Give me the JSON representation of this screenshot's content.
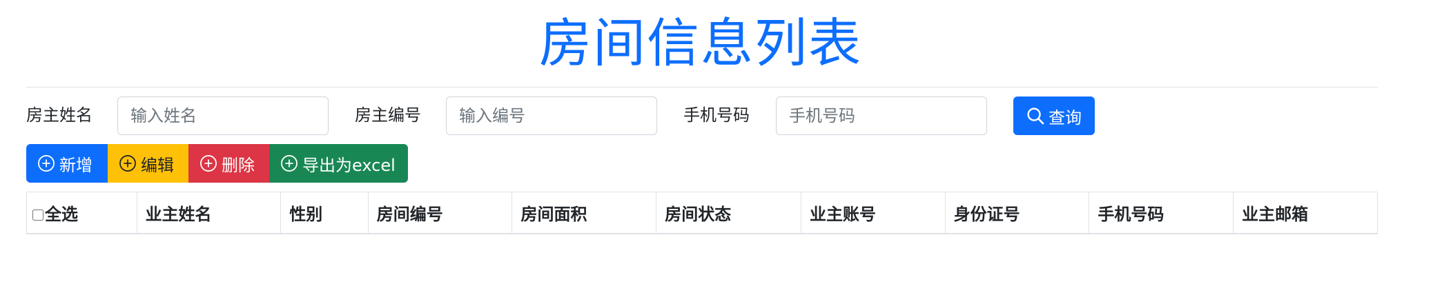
{
  "page": {
    "title": "房间信息列表"
  },
  "search": {
    "owner_name_label": "房主姓名",
    "owner_name_placeholder": "输入姓名",
    "owner_name_value": "",
    "owner_id_label": "房主编号",
    "owner_id_placeholder": "输入编号",
    "owner_id_value": "",
    "phone_label": "手机号码",
    "phone_placeholder": "手机号码",
    "phone_value": "",
    "query_label": "查询",
    "query_icon": "search-icon"
  },
  "toolbar": {
    "add_label": "新增",
    "edit_label": "编辑",
    "delete_label": "删除",
    "export_label": "导出为excel",
    "button_icon": "plus-circle-icon"
  },
  "colors": {
    "primary": "#0d6efd",
    "warning": "#ffc107",
    "danger": "#dc3545",
    "success": "#198754",
    "border": "#dee2e6"
  },
  "table": {
    "select_all_label": "全选",
    "select_all_checked": false,
    "columns": [
      "业主姓名",
      "性别",
      "房间编号",
      "房间面积",
      "房间状态",
      "业主账号",
      "身份证号",
      "手机号码",
      "业主邮箱"
    ],
    "rows": []
  }
}
